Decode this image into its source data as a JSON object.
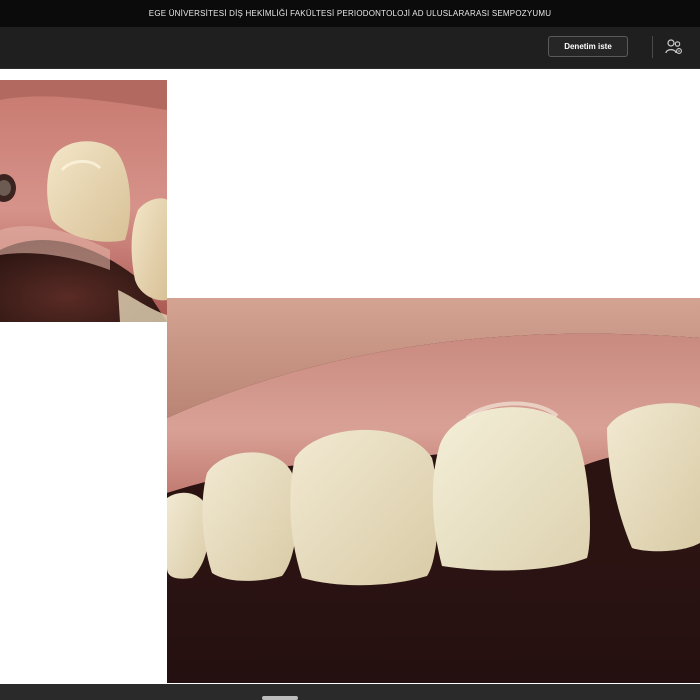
{
  "window": {
    "title": "EGE ÜNİVERSİTESİ DİŞ HEKİMLİĞİ FAKÜLTESİ PERIODONTOLOJİ AD ULUSLARARASI SEMPOZYUMU"
  },
  "toolbar": {
    "request_control_label": "Denetim iste",
    "participants_icon": "people-settings-icon"
  },
  "shared_screen": {
    "slide_images": [
      {
        "name": "clinical-photo-implant-site",
        "subject": "maxillary anterior implant site"
      },
      {
        "name": "clinical-photo-crown-result",
        "subject": "maxillary anterior crown restoration"
      }
    ]
  },
  "colors": {
    "titlebar_bg": "#0b0b0b",
    "toolbar_bg": "#1f1f1f",
    "slide_bg": "#ffffff"
  }
}
